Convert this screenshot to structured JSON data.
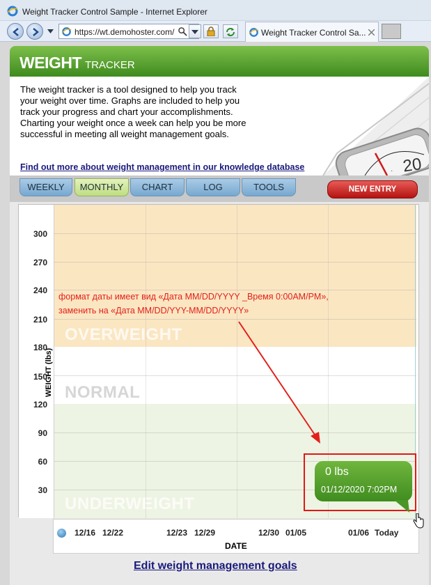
{
  "browser": {
    "window_title": "Weight Tracker Control Sample - Internet Explorer",
    "address": "https://wt.demohoster.com/",
    "tab_title": "Weight Tracker Control Sa..."
  },
  "header": {
    "logo_main": "WEIGHT",
    "logo_sub": "TRACKER"
  },
  "intro": {
    "text": "The weight tracker is a tool designed to help you track your weight over time. Graphs are included to help you track your progress and chart your accomplishments. Charting your weight once a week can help you be more successful in meeting all weight management goals.",
    "link": "Find out more about weight management in our knowledge database"
  },
  "tabs": [
    {
      "label": "WEEKLY",
      "active": false
    },
    {
      "label": "MONTHLY",
      "active": true
    },
    {
      "label": "CHART",
      "active": false
    },
    {
      "label": "LOG",
      "active": false
    },
    {
      "label": "TOOLS",
      "active": false
    }
  ],
  "new_entry_label": "NEW ENTRY",
  "chart": {
    "ylabel": "WEIGHT (lbs)",
    "yticks": [
      "300",
      "270",
      "240",
      "210",
      "180",
      "150",
      "120",
      "90",
      "60",
      "30"
    ],
    "zones": {
      "overweight": "OVERWEIGHT",
      "normal": "NORMAL",
      "underweight": "UNDERWEIGHT"
    },
    "xticks": [
      "12/16",
      "12/22",
      "12/23",
      "12/29",
      "12/30",
      "01/05",
      "01/06",
      "Today"
    ],
    "xlabel": "DATE"
  },
  "chart_data": {
    "type": "line",
    "ylabel": "WEIGHT (lbs)",
    "xlabel": "DATE",
    "ylim": [
      0,
      330
    ],
    "yticks": [
      30,
      60,
      90,
      120,
      150,
      180,
      210,
      240,
      270,
      300
    ],
    "x": [
      "12/16 12/22",
      "12/23 12/29",
      "12/30 01/05",
      "01/06 Today"
    ],
    "zones": [
      {
        "name": "OVERWEIGHT",
        "from": 180,
        "to": 330,
        "color": "#fbe6c2"
      },
      {
        "name": "NORMAL",
        "from": 120,
        "to": 180,
        "color": "#ffffff"
      },
      {
        "name": "UNDERWEIGHT",
        "from": 0,
        "to": 120,
        "color": "#eef4e3"
      }
    ],
    "series": [
      {
        "values": [
          {
            "date": "01/12/2020 7:02PM",
            "value": 0
          }
        ]
      }
    ]
  },
  "tooltip": {
    "value": "0 lbs",
    "datetime": "01/12/2020  7:02PM"
  },
  "annotation": {
    "line1": "формат даты имеет вид «Дата MM/DD/YYYY _Время 0:00AM/PM»,",
    "line2": "заменить на «Дата MM/DD/YYY-MM/DD/YYYY»",
    "color": "#e3201b"
  },
  "footer_link": "Edit weight management goals"
}
